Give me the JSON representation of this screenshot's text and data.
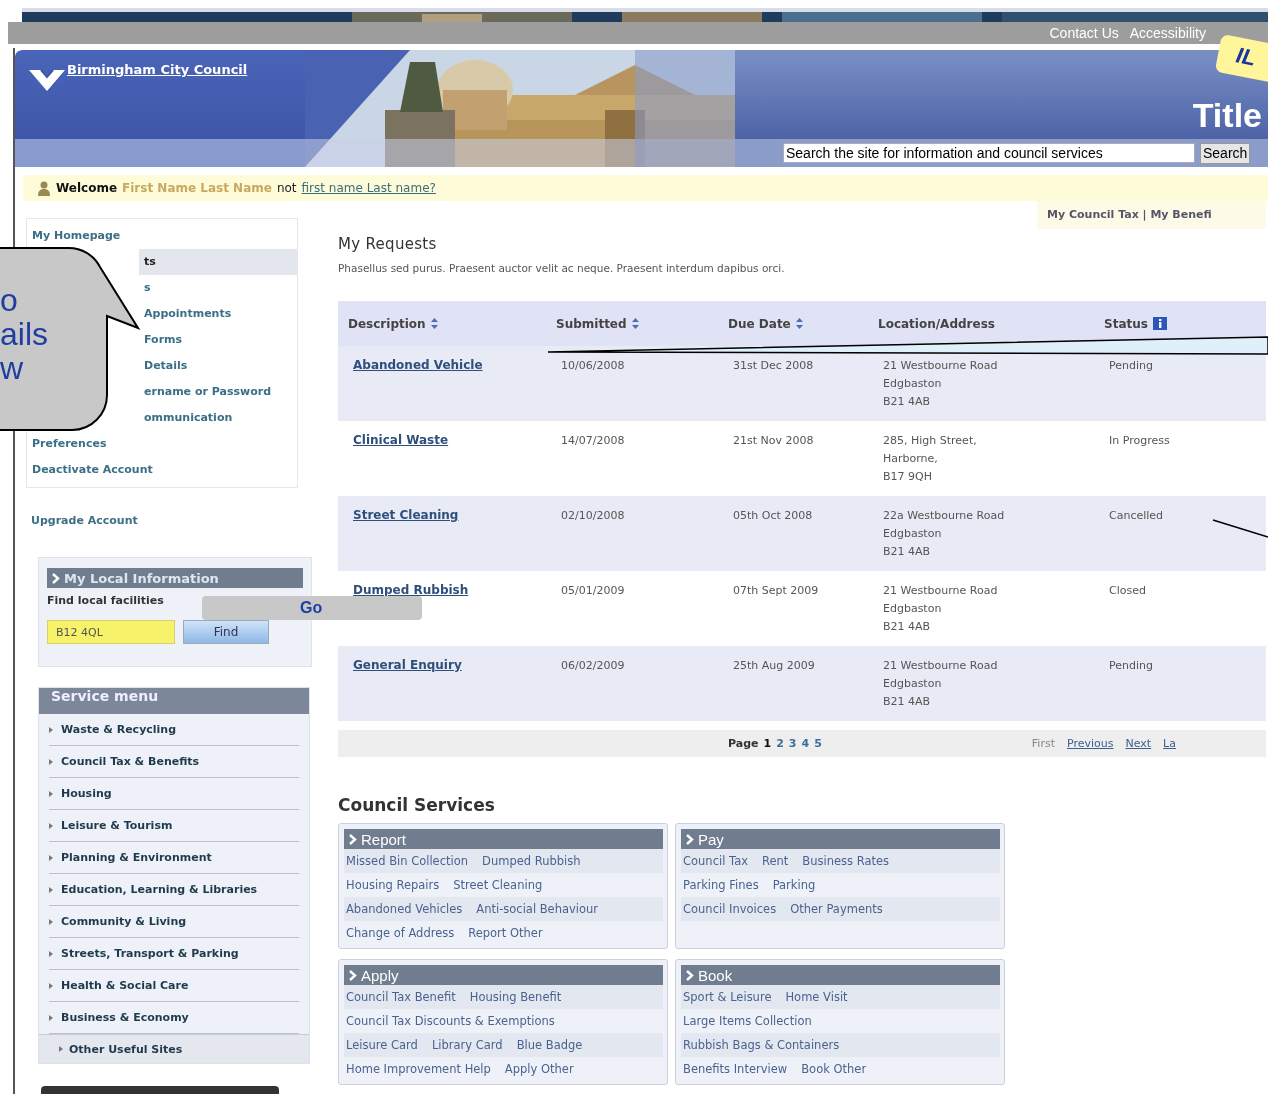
{
  "top_links": [
    {
      "label": "Contact Us"
    },
    {
      "label": "Accessibility"
    }
  ],
  "sticky_note": {
    "text": "IL"
  },
  "header": {
    "logo": "Birmingham City Council",
    "title": "Title",
    "search": {
      "value": "Search the site for information and council services",
      "button": "Search"
    }
  },
  "welcome": {
    "label": "Welcome",
    "name": "First Name Last Name",
    "joiner": "not",
    "link": "first name Last name?"
  },
  "sidebar": {
    "items": [
      {
        "label": "My Homepage",
        "selected": false,
        "covered": false
      },
      {
        "label": "ts",
        "selected": true,
        "covered": true
      },
      {
        "label": "s",
        "selected": false,
        "covered": true
      },
      {
        "label": "Appointments",
        "selected": false,
        "covered": true
      },
      {
        "label": "Forms",
        "selected": false,
        "covered": true
      },
      {
        "label": "Details",
        "selected": false,
        "covered": true
      },
      {
        "label": "ername or Password",
        "selected": false,
        "covered": true
      },
      {
        "label": "ommunication",
        "selected": false,
        "covered": true
      },
      {
        "label": "Preferences",
        "selected": false,
        "covered": false
      },
      {
        "label": "Deactivate Account",
        "selected": false,
        "covered": false
      }
    ],
    "upgrade": "Upgrade Account",
    "local_info": {
      "title": "My Local Information",
      "text": "Find local facilities",
      "postcode": "B12 4QL",
      "button": "Find"
    },
    "service_menu": {
      "title": "Service menu",
      "items": [
        "Waste & Recycling",
        "Council Tax & Benefits",
        "Housing",
        "Leisure & Tourism",
        "Planning & Environment",
        "Education, Learning & Libraries",
        "Community & Living",
        "Streets, Transport & Parking",
        "Health & Social Care",
        "Business & Economy"
      ],
      "other": "Other Useful Sites"
    }
  },
  "account_links": "My Council Tax | My Benefi",
  "requests": {
    "title": "My Requests",
    "intro": "Phasellus sed purus. Praesent auctor velit ac neque. Praesent interdum dapibus orci.",
    "columns": [
      {
        "label": "Description",
        "sortable": true,
        "info": false
      },
      {
        "label": "Submitted",
        "sortable": true,
        "info": false
      },
      {
        "label": "Due Date",
        "sortable": true,
        "info": false
      },
      {
        "label": "Location/Address",
        "sortable": false,
        "info": false
      },
      {
        "label": "Status",
        "sortable": false,
        "info": true
      }
    ],
    "rows": [
      {
        "description": "Abandoned Vehicle",
        "submitted": "10/06/2008",
        "due": "31st Dec 2008",
        "address": [
          "21 Westbourne Road",
          "Edgbaston",
          "B21 4AB"
        ],
        "status": "Pending"
      },
      {
        "description": "Clinical Waste",
        "submitted": "14/07/2008",
        "due": "21st Nov 2008",
        "address": [
          "285, High Street,",
          "Harborne,",
          "B17 9QH"
        ],
        "status": "In Progress"
      },
      {
        "description": "Street Cleaning",
        "submitted": "02/10/2008",
        "due": "05th Oct 2008",
        "address": [
          "22a Westbourne Road",
          "Edgbaston",
          "B21 4AB"
        ],
        "status": "Cancelled"
      },
      {
        "description": "Dumped Rubbish",
        "submitted": "05/01/2009",
        "due": "07th Sept 2009",
        "address": [
          "21 Westbourne Road",
          "Edgbaston",
          "B21 4AB"
        ],
        "status": "Closed"
      },
      {
        "description": "General Enquiry",
        "submitted": "06/02/2009",
        "due": "25th Aug 2009",
        "address": [
          "21 Westbourne Road",
          "Edgbaston",
          "B21 4AB"
        ],
        "status": "Pending"
      }
    ],
    "pagination": {
      "label": "Page",
      "pages": [
        {
          "label": "1",
          "selected": true
        },
        {
          "label": "2",
          "selected": false
        },
        {
          "label": "3",
          "selected": false
        },
        {
          "label": "4",
          "selected": false
        },
        {
          "label": "5",
          "selected": false
        }
      ],
      "nav": [
        {
          "label": "First",
          "disabled": true
        },
        {
          "label": "Previous",
          "disabled": false
        },
        {
          "label": "Next",
          "disabled": false
        },
        {
          "label": "La",
          "disabled": false
        }
      ]
    }
  },
  "services": {
    "title": "Council Services",
    "panels": [
      {
        "title": "Report",
        "rows": [
          [
            "Missed Bin Collection",
            "Dumped Rubbish"
          ],
          [
            "Housing Repairs",
            "Street Cleaning"
          ],
          [
            "Abandoned Vehicles",
            "Anti-social Behaviour"
          ],
          [
            "Change of Address",
            "Report Other"
          ]
        ]
      },
      {
        "title": "Pay",
        "rows": [
          [
            "Council Tax",
            "Rent",
            "Business Rates"
          ],
          [
            "Parking Fines",
            "Parking"
          ],
          [
            "Council Invoices",
            "Other Payments"
          ]
        ]
      },
      {
        "title": "Apply",
        "rows": [
          [
            "Council Tax Benefit",
            "Housing Benefit"
          ],
          [
            "Council Tax Discounts & Exemptions"
          ],
          [
            "Leisure Card",
            "Library Card",
            "Blue Badge"
          ],
          [
            "Home Improvement Help",
            "Apply Other"
          ]
        ]
      },
      {
        "title": "Book",
        "rows": [
          [
            "Sport & Leisure",
            "Home Visit"
          ],
          [
            "Large Items Collection"
          ],
          [
            "Rubbish Bags & Containers"
          ],
          [
            "Benefits Interview",
            "Book Other"
          ]
        ]
      }
    ]
  },
  "callout": {
    "lines": [
      "o",
      "ails",
      "w"
    ]
  },
  "go_button": {
    "label": "Go"
  }
}
